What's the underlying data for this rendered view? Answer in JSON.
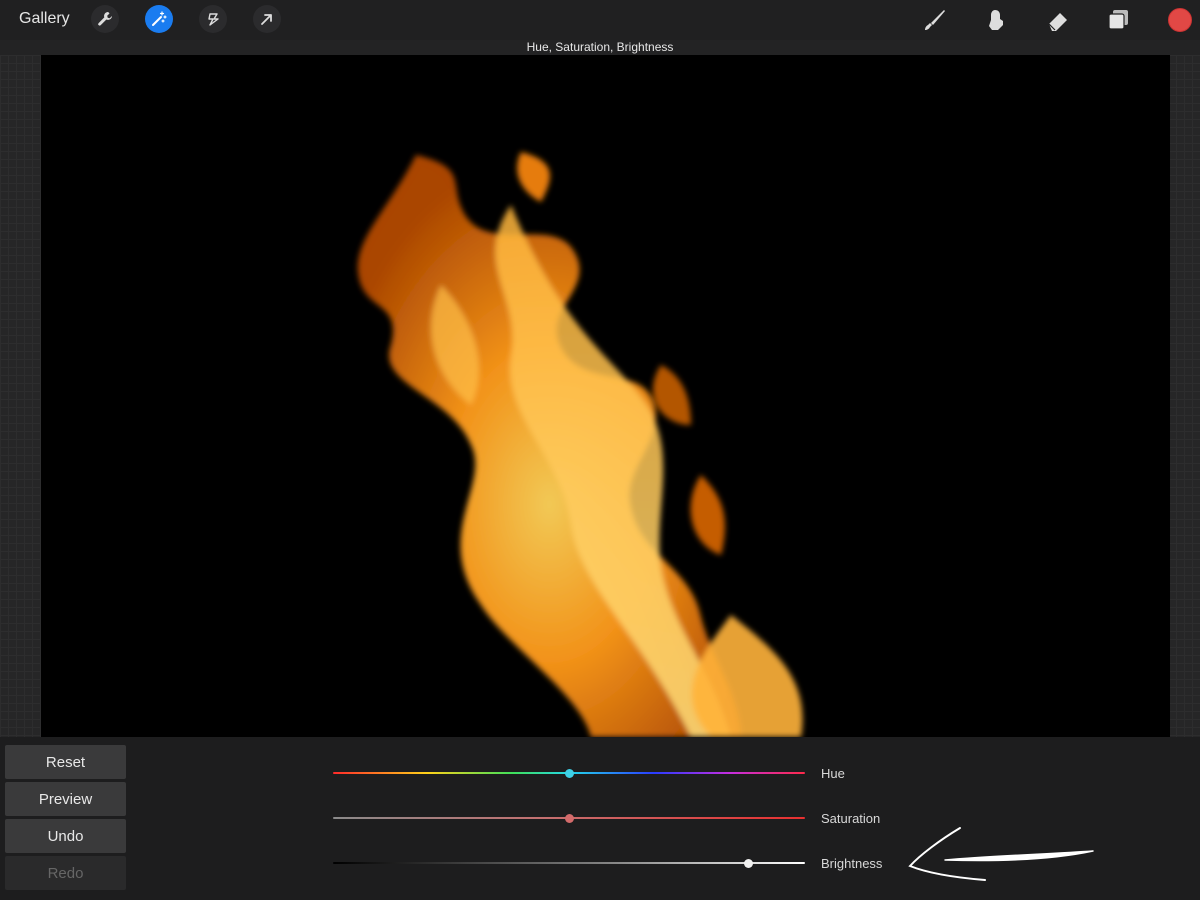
{
  "topbar": {
    "gallery_label": "Gallery",
    "left_tools": [
      "wrench-icon",
      "magic-wand-icon",
      "selection-icon",
      "transform-arrow-icon"
    ],
    "active_tool": "magic-wand-icon",
    "right_tools": [
      "brush-icon",
      "smudge-icon",
      "eraser-icon",
      "layers-icon"
    ],
    "current_color": "#e14845"
  },
  "adjustment_title": "Hue, Saturation, Brightness",
  "buttons": {
    "reset": "Reset",
    "preview": "Preview",
    "undo": "Undo",
    "redo": "Redo"
  },
  "sliders": [
    {
      "label": "Hue",
      "value": 0.5
    },
    {
      "label": "Saturation",
      "value": 0.5
    },
    {
      "label": "Brightness",
      "value": 0.88
    }
  ],
  "colors": {
    "accent": "#1a7cf0",
    "hue_thumb": "#3fd0e6",
    "saturation_thumb": "#d36b6b",
    "brightness_thumb": "#f0f0f0"
  }
}
